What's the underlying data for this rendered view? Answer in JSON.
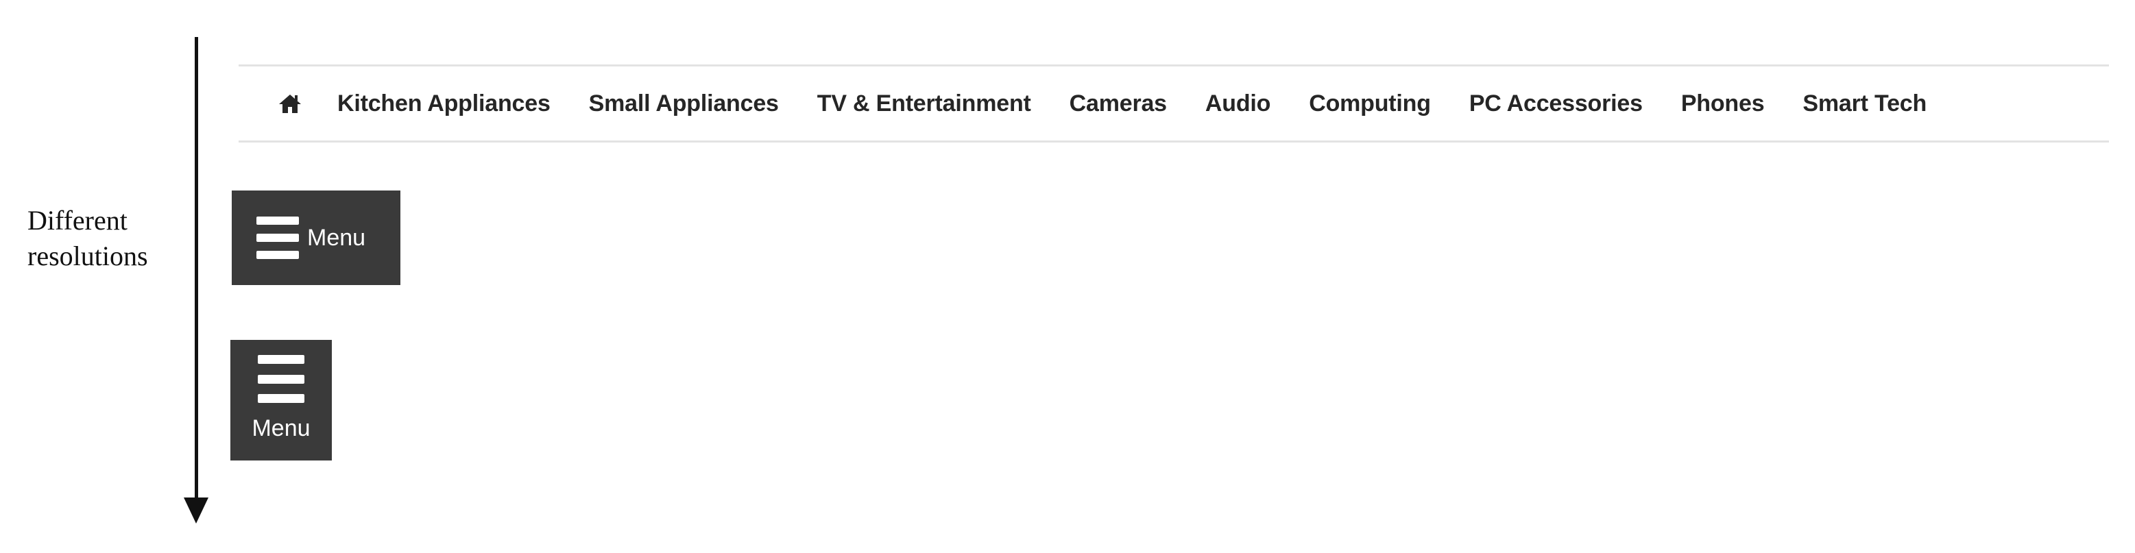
{
  "annotation": {
    "line1": "Different",
    "line2": "resolutions"
  },
  "navbar": {
    "home_icon": "home-icon",
    "items": [
      "Kitchen Appliances",
      "Small Appliances",
      "TV & Entertainment",
      "Cameras",
      "Audio",
      "Computing",
      "PC Accessories",
      "Phones",
      "Smart Tech"
    ]
  },
  "menu_wide": {
    "icon": "hamburger-icon",
    "label": "Menu"
  },
  "menu_compact": {
    "icon": "hamburger-icon",
    "label": "Menu"
  },
  "colors": {
    "nav_text": "#262626",
    "nav_border": "#e3e3e3",
    "menu_bg": "#3a3a3a",
    "menu_text": "#ffffff"
  }
}
